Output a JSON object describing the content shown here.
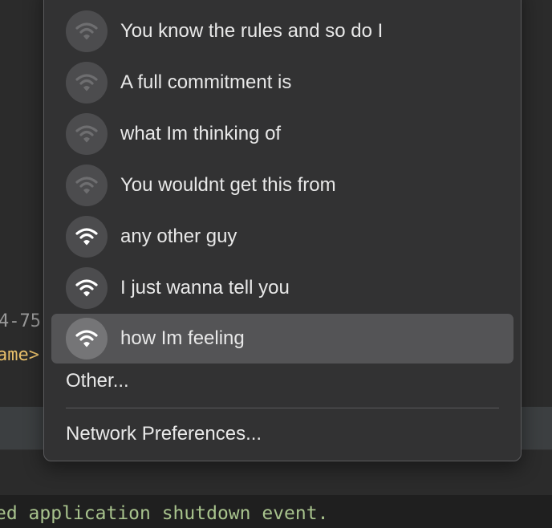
{
  "background": {
    "code_fragment_1": "4-75",
    "code_fragment_2": "ame>",
    "console_text": "ed application shutdown event."
  },
  "wifi_menu": {
    "networks": [
      {
        "name": "You know the rules and so do I",
        "signal": "weak",
        "icon": "wifi-icon"
      },
      {
        "name": "A full commitment is",
        "signal": "weak",
        "icon": "wifi-icon"
      },
      {
        "name": "what Im thinking of",
        "signal": "weak",
        "icon": "wifi-icon"
      },
      {
        "name": "You wouldnt get this from",
        "signal": "weak",
        "icon": "wifi-icon"
      },
      {
        "name": "any other guy",
        "signal": "strong",
        "icon": "wifi-icon"
      },
      {
        "name": "I just wanna tell you",
        "signal": "strong",
        "icon": "wifi-icon"
      },
      {
        "name": "how Im feeling",
        "signal": "strong",
        "icon": "wifi-icon",
        "selected": true
      }
    ],
    "other_label": "Other...",
    "preferences_label": "Network Preferences..."
  },
  "colors": {
    "menu_bg": "#323233",
    "selected_bg": "#545456",
    "wifi_strong": "#ffffff",
    "wifi_weak": "#6e6e70"
  }
}
